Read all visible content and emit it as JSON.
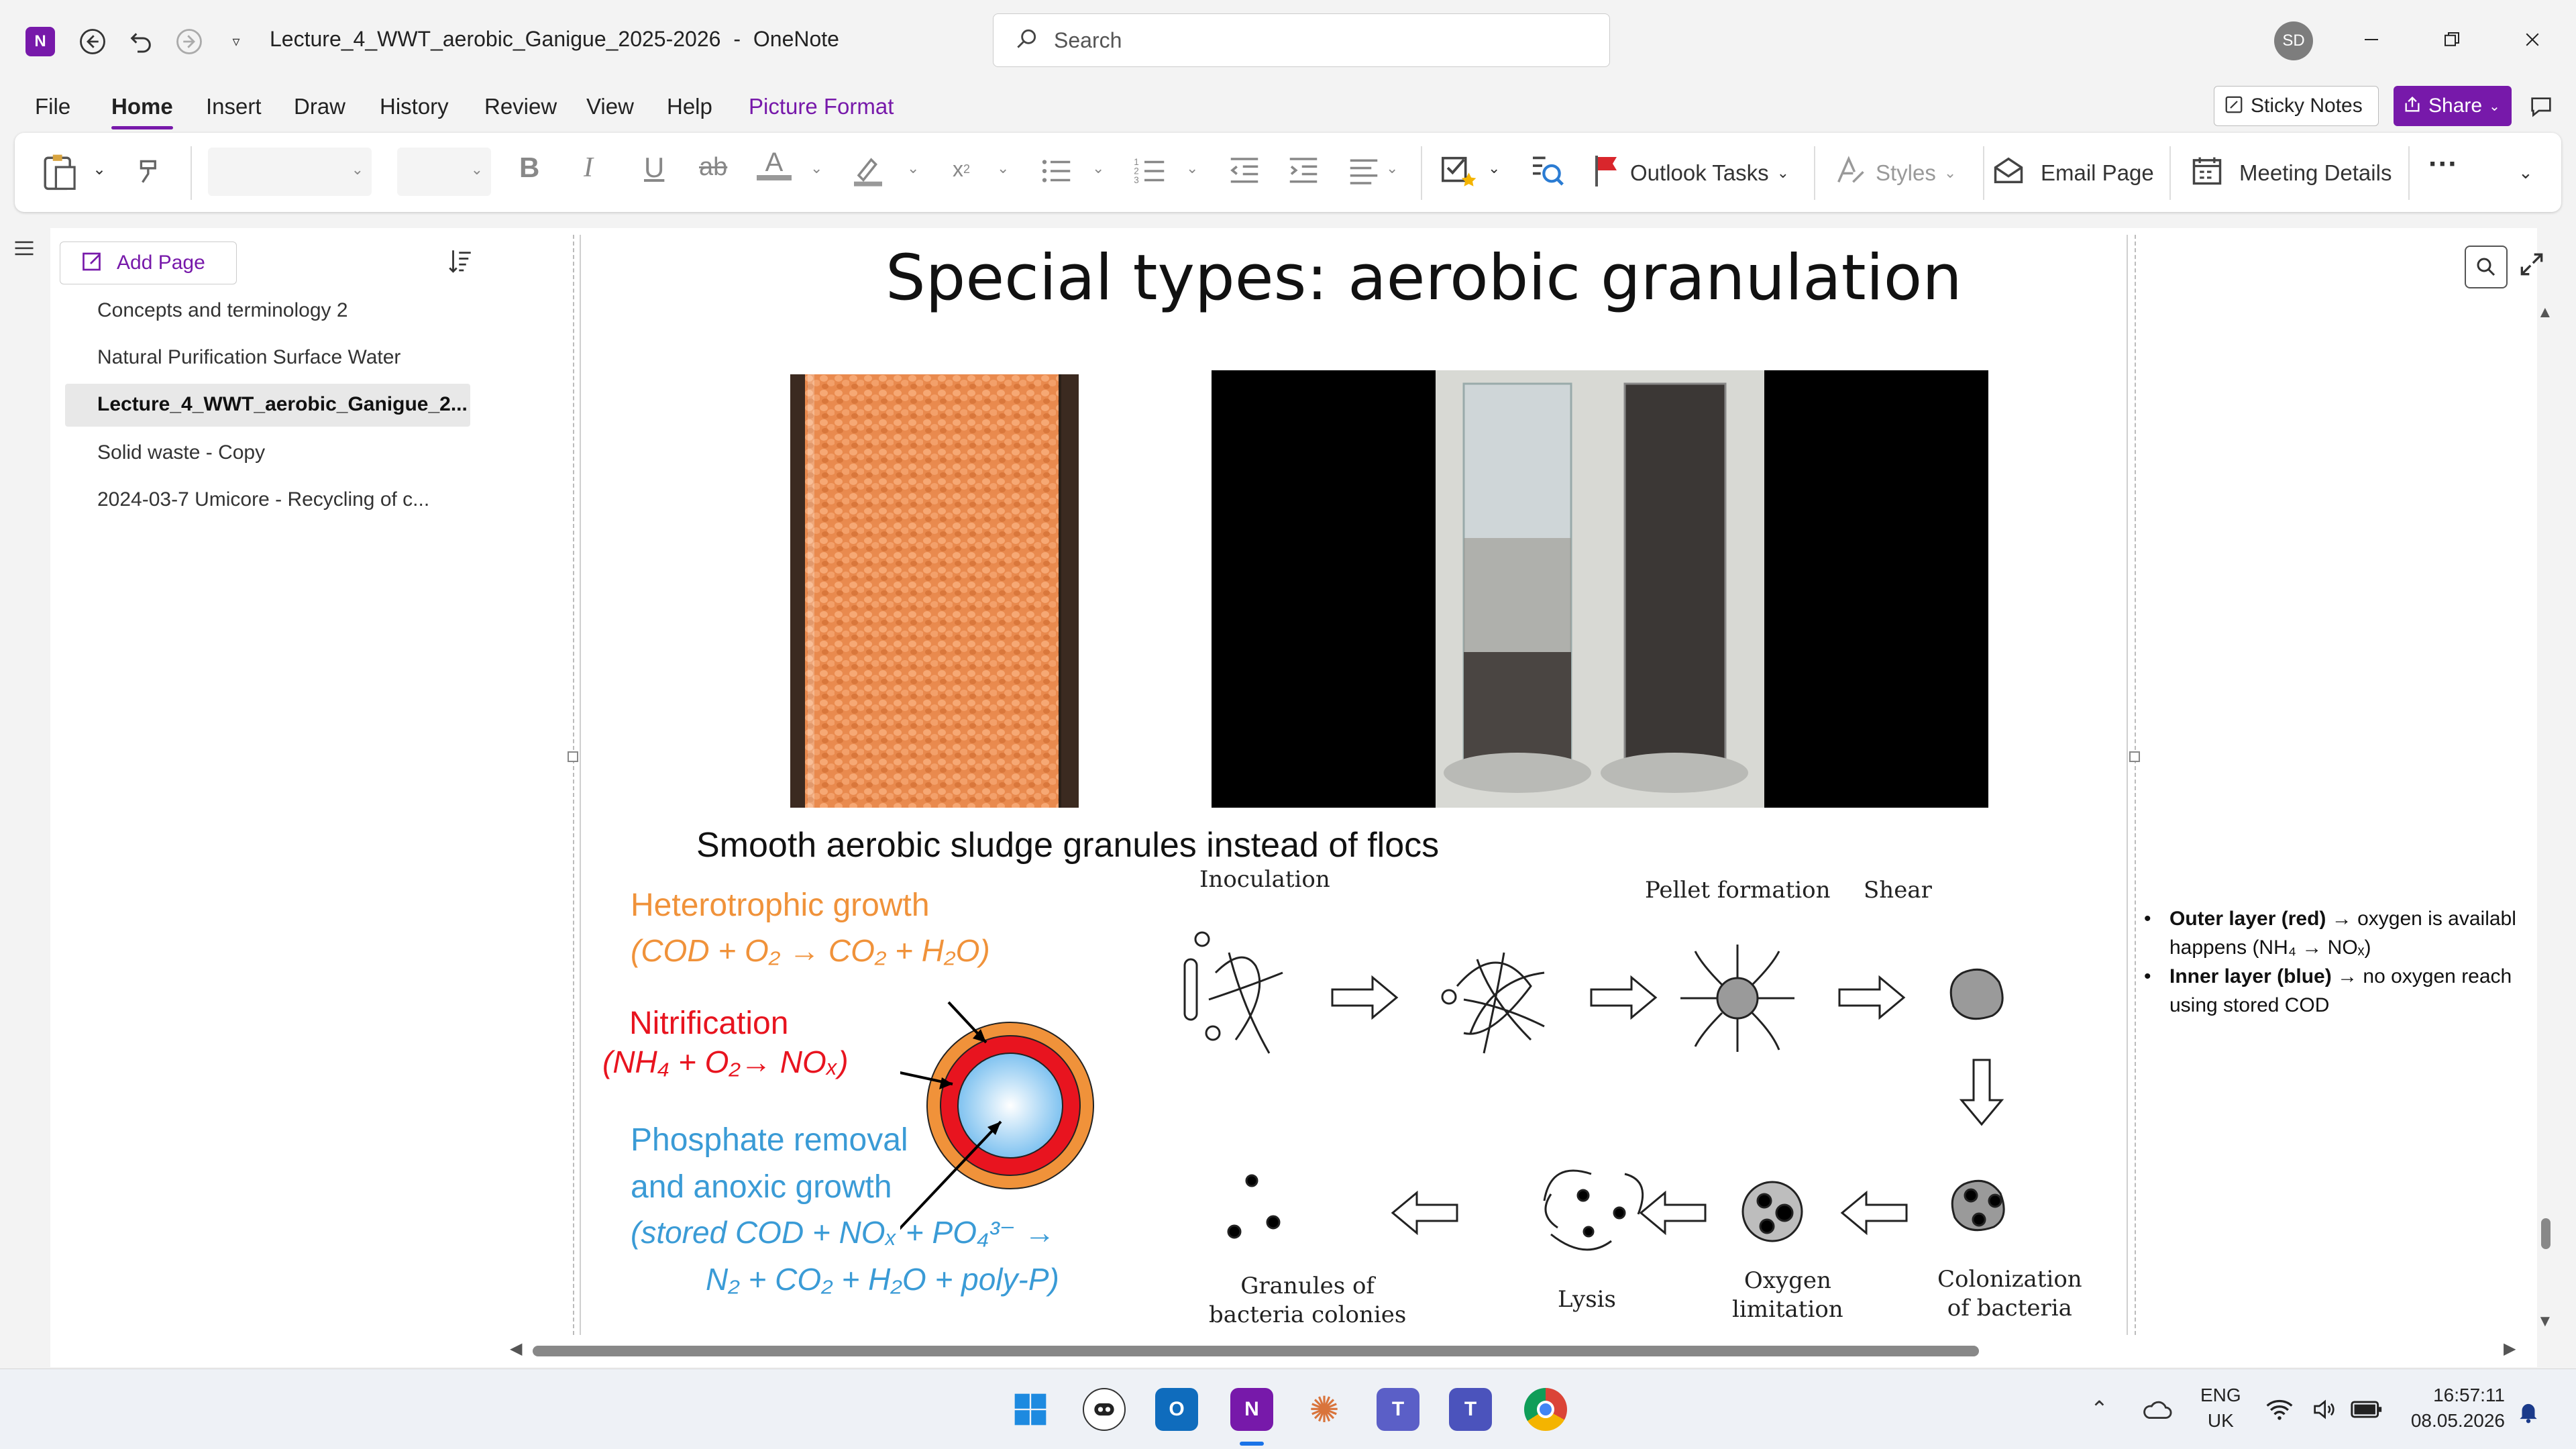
{
  "window": {
    "doc_title": "Lecture_4_WWT_aerobic_Ganigue_2025-2026",
    "app_name": "OneNote",
    "title_sep": "-",
    "search_placeholder": "Search",
    "user_initials": "SD"
  },
  "menu": {
    "items": [
      "File",
      "Home",
      "Insert",
      "Draw",
      "History",
      "Review",
      "View",
      "Help",
      "Picture Format"
    ],
    "active": "Home",
    "sticky_notes": "Sticky Notes",
    "share": "Share"
  },
  "ribbon": {
    "outlook_tasks": "Outlook Tasks",
    "styles": "Styles",
    "email_page": "Email Page",
    "meeting_details": "Meeting Details"
  },
  "sidebar": {
    "add_page": "Add Page",
    "pages": [
      "Concepts and terminology 2",
      "Natural Purification Surface Water",
      "Lecture_4_WWT_aerobic_Ganigue_2...",
      "Solid waste - Copy",
      "2024-03-7 Umicore - Recycling of c..."
    ],
    "selected_index": 2
  },
  "slide": {
    "title": "Special types: aerobic granulation",
    "caption": "Smooth aerobic sludge granules instead of flocs",
    "heterotrophic_title": "Heterotrophic growth",
    "heterotrophic_formula": "(COD + O₂ → CO₂ + H₂O)",
    "nitrification_title": "Nitrification",
    "nitrification_formula": "(NH₄ + O₂→ NOₓ)",
    "phosphate_line1": "Phosphate removal",
    "phosphate_line2": "and anoxic growth",
    "phosphate_formula1": "(stored COD + NOₓ + PO₄³⁻ →",
    "phosphate_formula2": "N₂ + CO₂ + H₂O + poly-P)",
    "colors": {
      "orange": "#f0923a",
      "red": "#e8141f",
      "blue": "#3a9bd6"
    }
  },
  "diagram": {
    "inoculation": "Inoculation",
    "pellet_formation": "Pellet formation",
    "shear": "Shear",
    "granules_line1": "Granules of",
    "granules_line2": "bacteria colonies",
    "lysis": "Lysis",
    "oxygen_line1": "Oxygen",
    "oxygen_line2": "limitation",
    "colonization_line1": "Colonization",
    "colonization_line2": "of bacteria"
  },
  "notes": {
    "outer_bold": "Outer layer (red)",
    "outer_rest": "→ oxygen is availabl",
    "outer_line2": "happens (NH₄ → NOₓ)",
    "inner_bold": "Inner layer (blue)",
    "inner_rest": "→ no oxygen reach",
    "inner_line2": "using stored COD"
  },
  "taskbar": {
    "lang": "ENG",
    "region": "UK",
    "time": "16:57:11",
    "date": "08.05.2026"
  }
}
